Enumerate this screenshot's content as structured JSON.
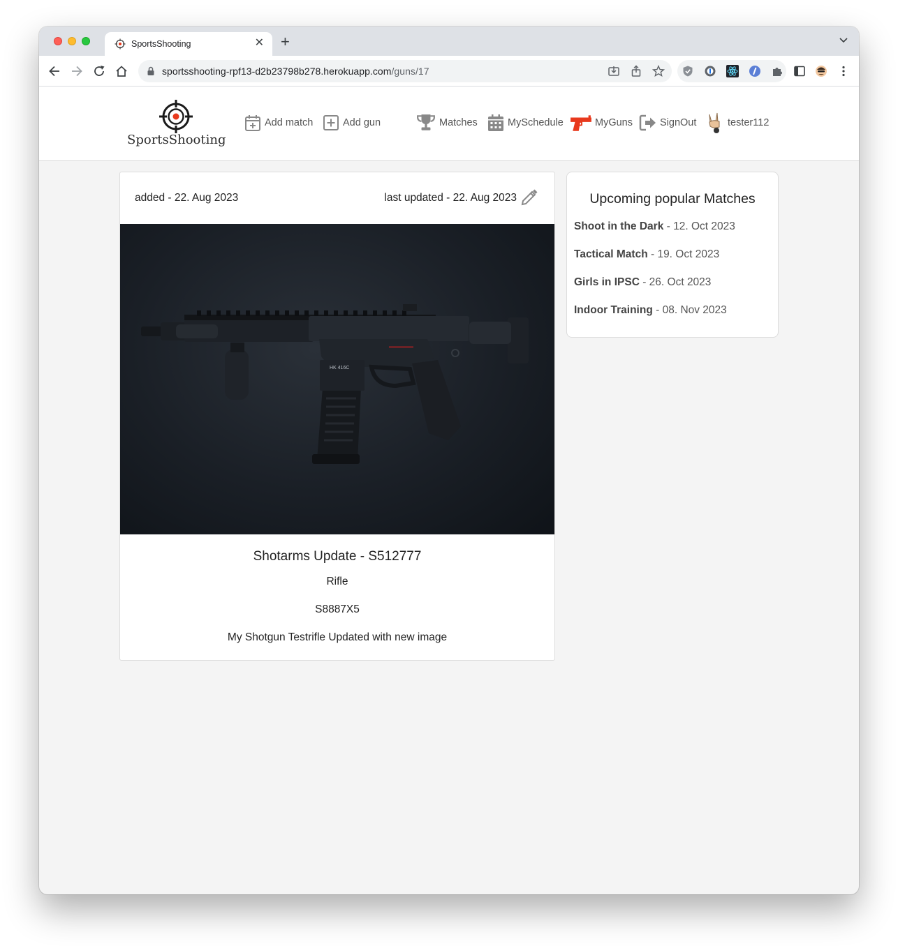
{
  "browser": {
    "tab_title": "SportsShooting",
    "url_host": "sportsshooting-rpf13-d2b23798b278.herokuapp.com",
    "url_path": "/guns/17"
  },
  "app": {
    "logo_text": "SportsShooting",
    "nav": {
      "add_match": "Add match",
      "add_gun": "Add gun",
      "matches": "Matches",
      "my_schedule": "MySchedule",
      "my_guns": "MyGuns",
      "sign_out": "SignOut",
      "user": "tester112"
    },
    "accent_color": "#e8391d"
  },
  "gun": {
    "added": "added - 22. Aug 2023",
    "updated": "last updated - 22. Aug 2023",
    "title": "Shotarms Update - S512777",
    "type": "Rifle",
    "serial": "S8887X5",
    "description": "My Shotgun Testrifle Updated with new image",
    "image_label": "HK 416C"
  },
  "sidebar": {
    "title": "Upcoming popular Matches",
    "matches": [
      {
        "name": "Shoot in the Dark",
        "date": " - 12. Oct 2023"
      },
      {
        "name": "Tactical Match",
        "date": " - 19. Oct 2023"
      },
      {
        "name": "Girls in IPSC",
        "date": " - 26. Oct 2023"
      },
      {
        "name": "Indoor Training",
        "date": " - 08. Nov 2023"
      }
    ]
  }
}
